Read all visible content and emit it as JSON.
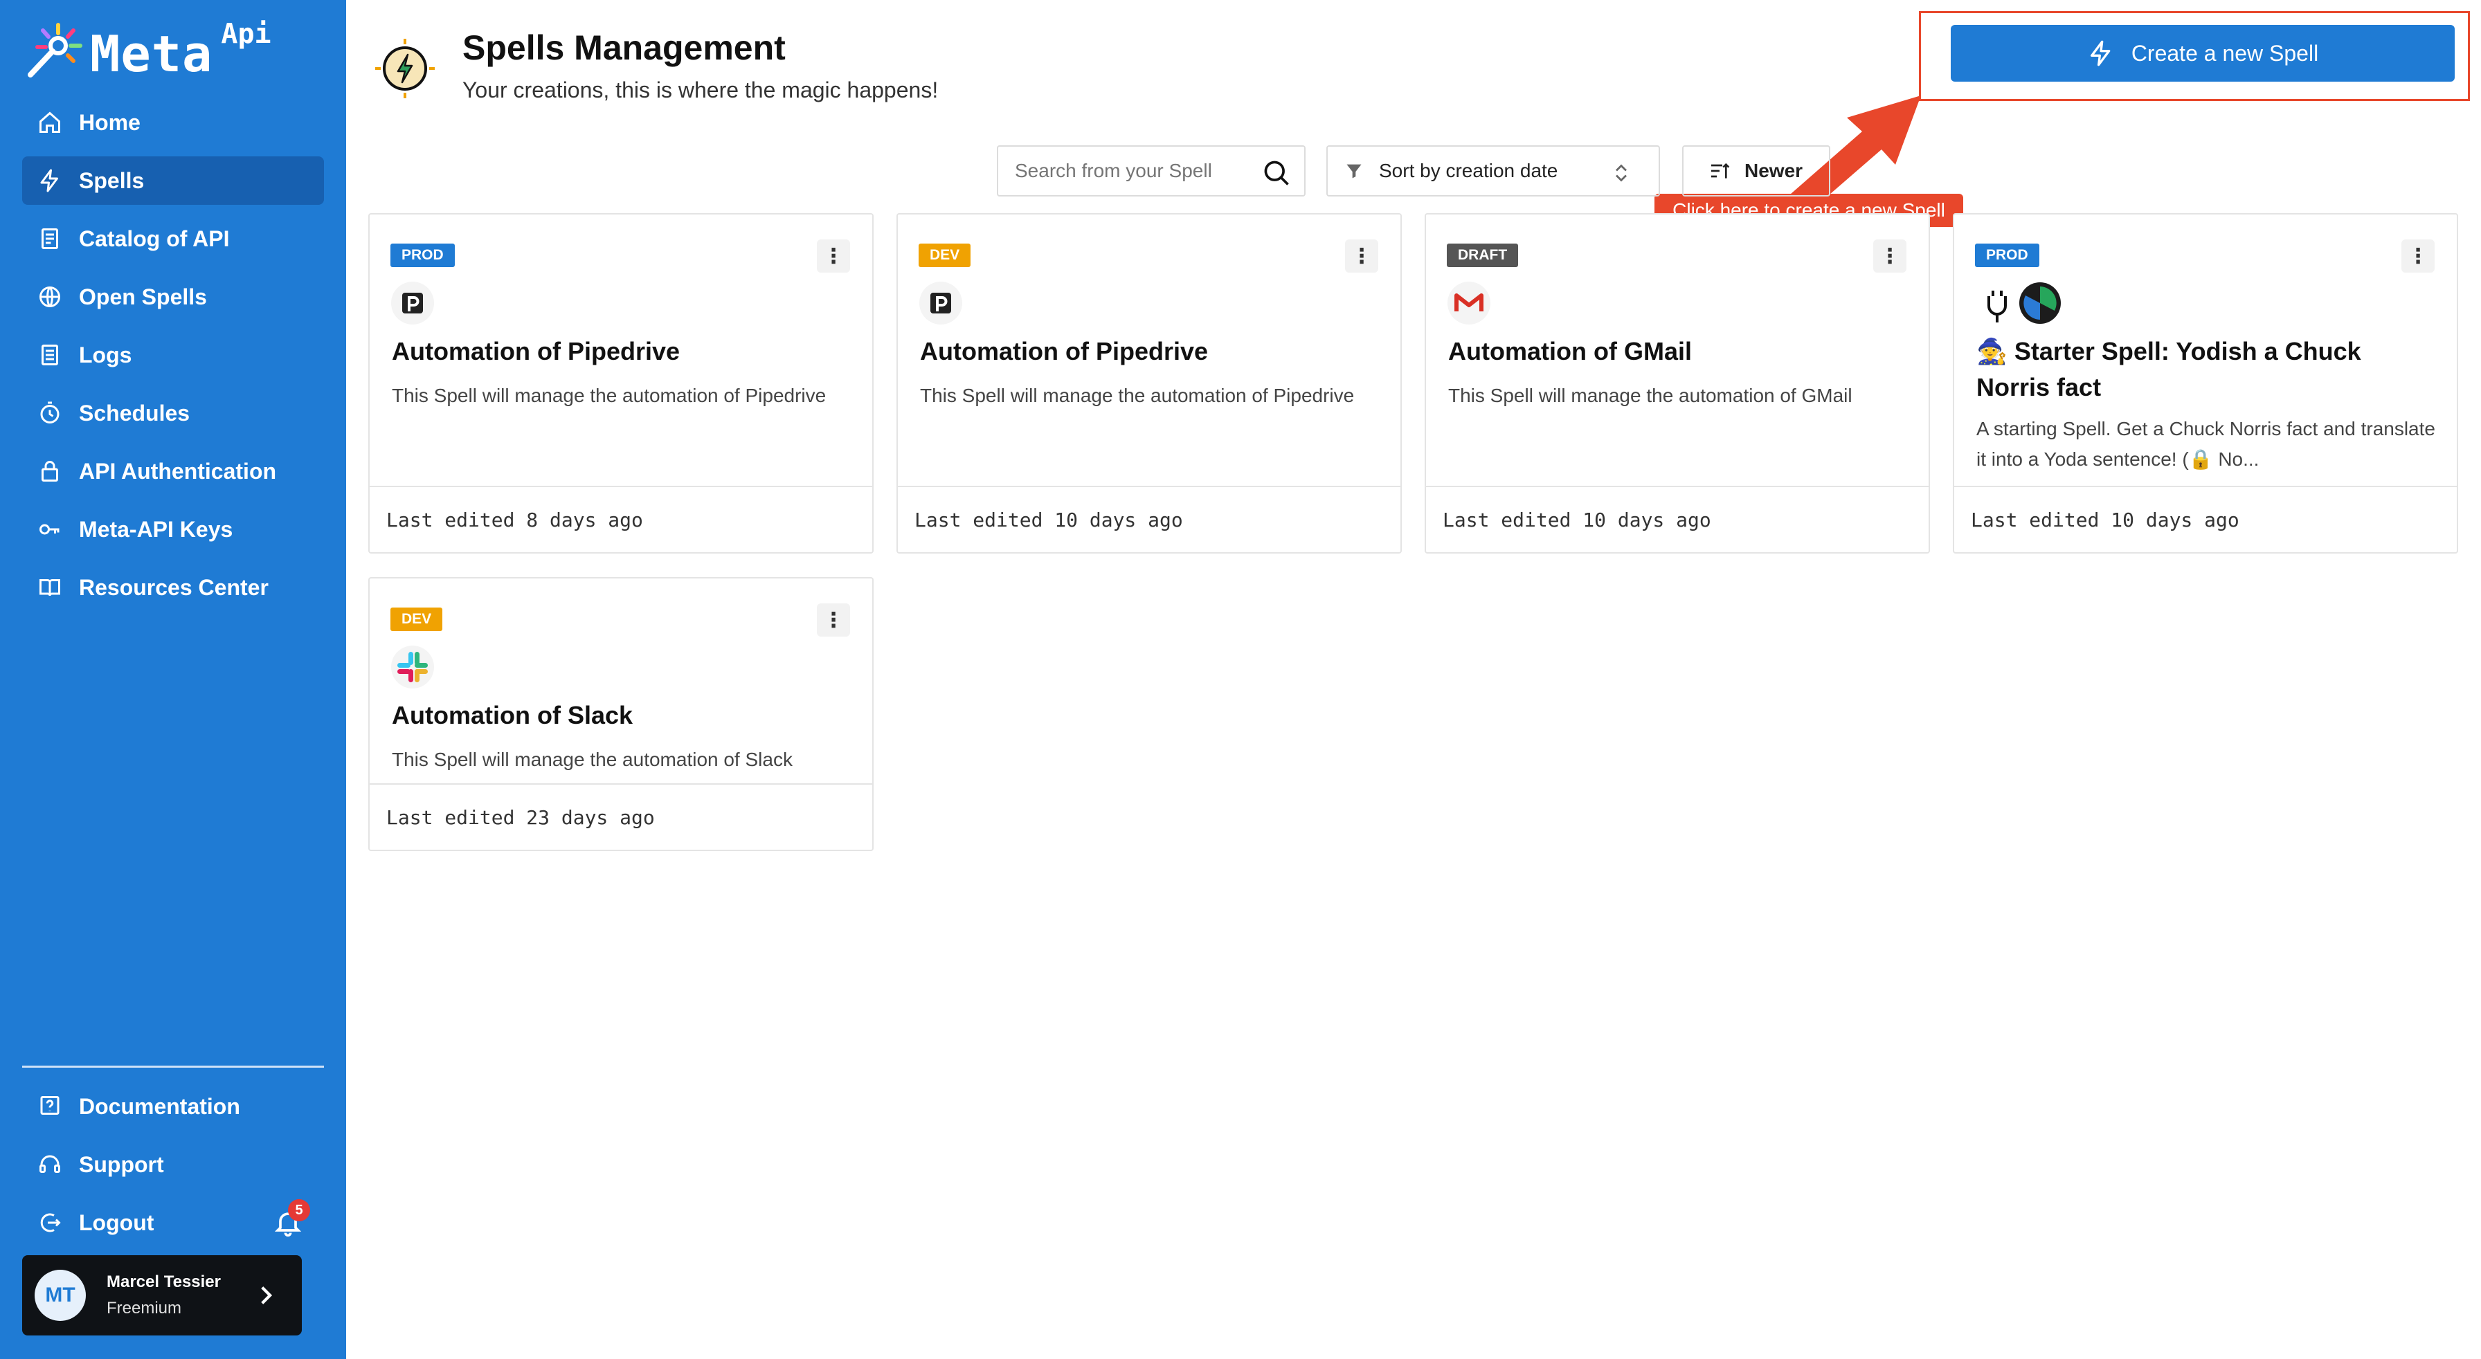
{
  "app": {
    "logo_text": "Meta",
    "logo_sup": "Api"
  },
  "sidebar": {
    "items": [
      {
        "label": "Home",
        "icon": "home-icon"
      },
      {
        "label": "Spells",
        "icon": "bolt-icon",
        "active": true
      },
      {
        "label": "Catalog of API",
        "icon": "catalog-icon"
      },
      {
        "label": "Open Spells",
        "icon": "globe-icon"
      },
      {
        "label": "Logs",
        "icon": "document-icon"
      },
      {
        "label": "Schedules",
        "icon": "stopwatch-icon"
      },
      {
        "label": "API Authentication",
        "icon": "lock-icon"
      },
      {
        "label": "Meta-API Keys",
        "icon": "key-icon"
      },
      {
        "label": "Resources Center",
        "icon": "book-icon"
      }
    ],
    "bottom_items": [
      {
        "label": "Documentation",
        "icon": "help-icon"
      },
      {
        "label": "Support",
        "icon": "headset-icon"
      },
      {
        "label": "Logout",
        "icon": "logout-icon"
      }
    ],
    "notifications_count": "5",
    "user": {
      "initials": "MT",
      "name": "Marcel Tessier",
      "plan": "Freemium"
    }
  },
  "header": {
    "title": "Spells Management",
    "subtitle": "Your creations, this is where the magic happens!",
    "create_button": "Create a new Spell",
    "tooltip": "Click here to create a new Spell"
  },
  "toolbar": {
    "search_placeholder": "Search from your Spell",
    "sort_label": "Sort by creation date",
    "order_label": "Newer"
  },
  "colors": {
    "primary": "#1f7bd4",
    "prod": "#1f7bd4",
    "dev": "#f0a202",
    "draft": "#555555",
    "annotation": "#e8472b"
  },
  "cards": [
    {
      "badge": "PROD",
      "app": "pipedrive",
      "title": "Automation of Pipedrive",
      "description": "This Spell will manage the automation of Pipedrive",
      "footer": "Last edited 8 days ago"
    },
    {
      "badge": "DEV",
      "app": "pipedrive",
      "title": "Automation of Pipedrive",
      "description": "This Spell will manage the automation of Pipedrive",
      "footer": "Last edited 10 days ago"
    },
    {
      "badge": "DRAFT",
      "app": "gmail",
      "title": "Automation of GMail",
      "description": "This Spell will manage the automation of GMail",
      "footer": "Last edited 10 days ago"
    },
    {
      "badge": "PROD",
      "app": "chuck-yoda",
      "title": "🧙 Starter Spell: Yodish a Chuck Norris fact",
      "description": "A starting Spell. Get a Chuck Norris fact and translate it into a Yoda sentence! (🔒 No...",
      "footer": "Last edited 10 days ago"
    },
    {
      "badge": "DEV",
      "app": "slack",
      "title": "Automation of Slack",
      "description": "This Spell will manage the automation of Slack",
      "footer": "Last edited 23 days ago"
    }
  ]
}
